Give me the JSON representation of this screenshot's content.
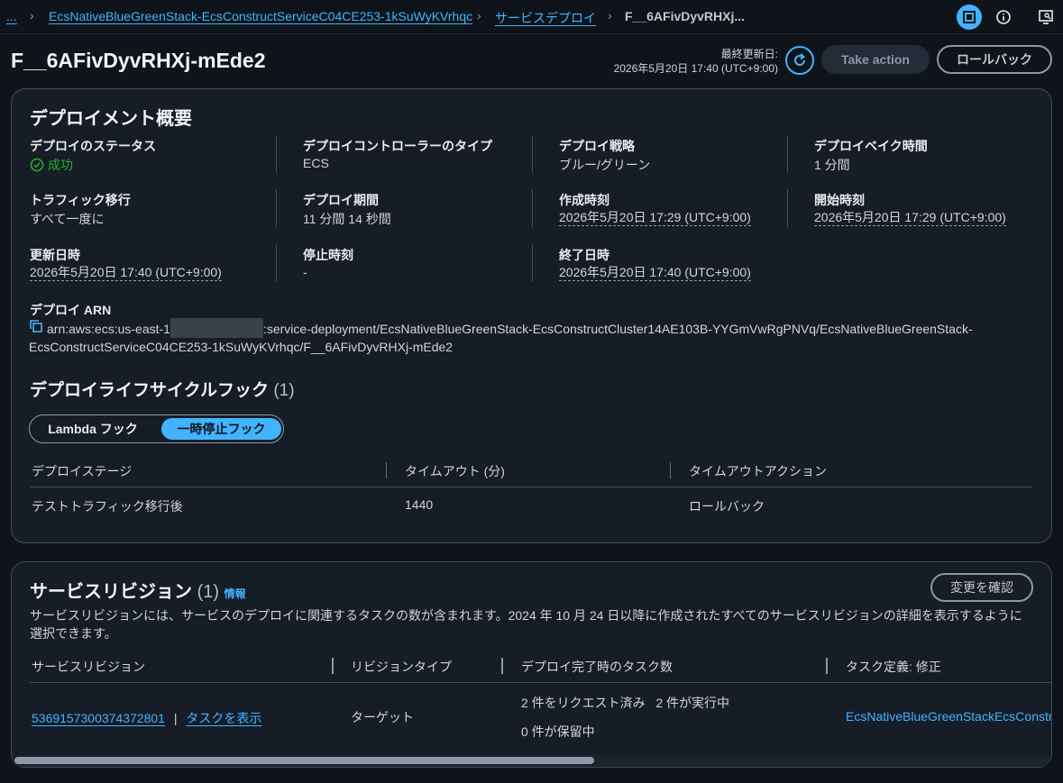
{
  "breadcrumbs": {
    "ellipsis": "...",
    "service": "EcsNativeBlueGreenStack-EcsConstructServiceC04CE253-1kSuWyKVrhqc",
    "deployments": "サービスデプロイ",
    "current": "F__6AFivDyvRHXj..."
  },
  "header": {
    "title": "F__6AFivDyvRHXj-mEde2",
    "last_updated_label": "最終更新日:",
    "last_updated_value": "2026年5月20日 17:40 (UTC+9:00)",
    "take_action": "Take action",
    "rollback": "ロールバック"
  },
  "overview": {
    "title": "デプロイメント概要",
    "status_label": "デプロイのステータス",
    "status_value": "成功",
    "controller_label": "デプロイコントローラーのタイプ",
    "controller_value": "ECS",
    "strategy_label": "デプロイ戦略",
    "strategy_value": "ブルー/グリーン",
    "bake_label": "デプロイベイク時間",
    "bake_value": "1 分間",
    "traffic_label": "トラフィック移行",
    "traffic_value": "すべて一度に",
    "duration_label": "デプロイ期間",
    "duration_value": "11 分間 14 秒間",
    "created_label": "作成時刻",
    "created_value": "2026年5月20日 17:29 (UTC+9:00)",
    "started_label": "開始時刻",
    "started_value": "2026年5月20日 17:29 (UTC+9:00)",
    "updated_label": "更新日時",
    "updated_value": "2026年5月20日 17:40 (UTC+9:00)",
    "stopped_label": "停止時刻",
    "stopped_value": "-",
    "ended_label": "終了日時",
    "ended_value": "2026年5月20日 17:40 (UTC+9:00)",
    "arn_label": "デプロイ ARN",
    "arn_prefix": "arn:aws:ecs:us-east-1",
    "arn_suffix": ":service-deployment/EcsNativeBlueGreenStack-EcsConstructCluster14AE103B-YYGmVwRgPNVq/EcsNativeBlueGreenStack-EcsConstructServiceC04CE253-1kSuWyKVrhqc/F__6AFivDyvRHXj-mEde2"
  },
  "hooks": {
    "title": "デプロイライフサイクルフック",
    "count": "(1)",
    "seg_lambda": "Lambda フック",
    "seg_pause": "一時停止フック",
    "col_stage": "デプロイステージ",
    "col_timeout": "タイムアウト (分)",
    "col_action": "タイムアウトアクション",
    "row_stage": "テストトラフィック移行後",
    "row_timeout": "1440",
    "row_action": "ロールバック"
  },
  "revisions": {
    "title": "サービスリビジョン",
    "count": "(1)",
    "info": "情報",
    "confirm": "変更を確認",
    "description": "サービスリビジョンには、サービスのデプロイに関連するタスクの数が含まれます。2024 年 10 月 24 日以降に作成されたすべてのサービスリビジョンの詳細を表示するように選択できます。",
    "col_revision": "サービスリビジョン",
    "col_type": "リビジョンタイプ",
    "col_tasks": "デプロイ完了時のタスク数",
    "col_taskdef": "タスク定義: 修正",
    "row_revision": "5369157300374372801",
    "row_pipe": "|",
    "row_view_tasks": "タスクを表示",
    "row_type": "ターゲット",
    "row_tasks_line1": "2 件をリクエスト済み   2 件が実行中",
    "row_tasks_line2": "0 件が保留中",
    "row_taskdef": "EcsNativeBlueGreenStackEcsConstru"
  },
  "colors": {
    "accent": "#42b4ff",
    "success": "#29ad32",
    "background": "#0f141a",
    "panel": "#161d26"
  }
}
